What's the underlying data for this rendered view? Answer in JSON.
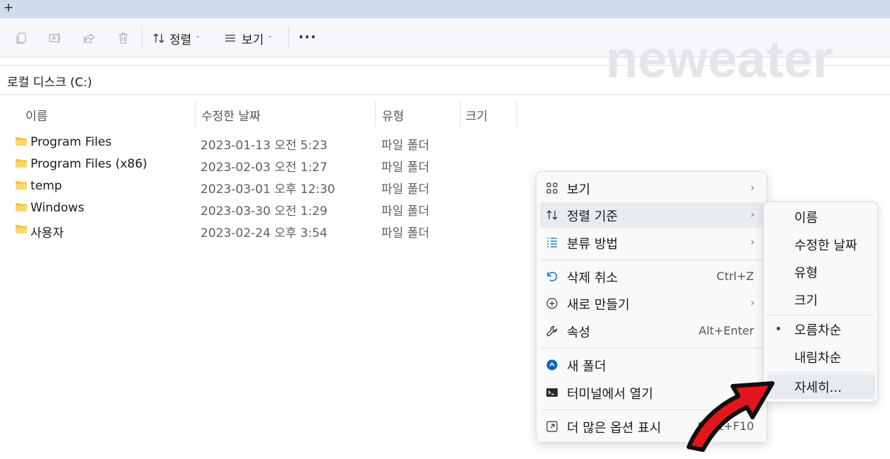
{
  "tabstrip": {
    "new_tab": "+"
  },
  "toolbar": {
    "icons": [
      "copy-icon",
      "rename-icon",
      "share-icon",
      "delete-icon"
    ],
    "sort_label": "정렬",
    "view_label": "보기",
    "more_label": "···"
  },
  "watermark": "neweater",
  "address": {
    "path": "로컬 디스크 (C:)"
  },
  "columns": {
    "name": "이름",
    "date": "수정한 날짜",
    "type": "유형",
    "size": "크기"
  },
  "files": [
    {
      "name": "Program Files",
      "date": "2023-01-13 오전 5:23",
      "type": "파일 폴더"
    },
    {
      "name": "Program Files (x86)",
      "date": "2023-02-03 오전 1:27",
      "type": "파일 폴더"
    },
    {
      "name": "temp",
      "date": "2023-03-01 오후 12:30",
      "type": "파일 폴더"
    },
    {
      "name": "Windows",
      "date": "2023-03-30 오전 1:29",
      "type": "파일 폴더"
    },
    {
      "name": "사용자",
      "date": "2023-02-24 오후 3:54",
      "type": "파일 폴더"
    }
  ],
  "context_menu": {
    "view": "보기",
    "sort_by": "정렬 기준",
    "group_by": "분류 방법",
    "undo": "삭제 취소",
    "undo_shortcut": "Ctrl+Z",
    "new": "새로 만들기",
    "properties": "속성",
    "properties_shortcut": "Alt+Enter",
    "new_folder": "새 폴더",
    "open_terminal": "터미널에서 열기",
    "more_options": "더 많은 옵션 표시",
    "more_options_shortcut": "Shift+F10"
  },
  "sort_submenu": {
    "name": "이름",
    "date": "수정한 날짜",
    "type": "유형",
    "size": "크기",
    "ascending": "오름차순",
    "descending": "내림차순",
    "more": "자세히..."
  },
  "colors": {
    "folder": "#f2c14e",
    "accent": "#0067c0",
    "arrow": "#e4161b"
  }
}
